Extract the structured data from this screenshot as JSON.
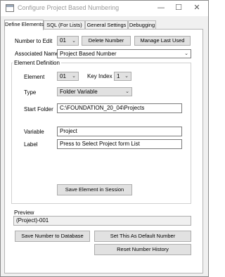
{
  "window": {
    "title": "Configure Project Based Numbering",
    "controls": {
      "minimize": "—",
      "maximize": "☐",
      "close": "✕"
    }
  },
  "tabs": [
    {
      "label": "Define Elements",
      "active": true
    },
    {
      "label": "SQL (For Lists)",
      "active": false
    },
    {
      "label": "General Settings",
      "active": false
    },
    {
      "label": "Debugging",
      "active": false
    }
  ],
  "top": {
    "number_label": "Number to Edit",
    "number_value": "01",
    "delete_button": "Delete Number",
    "manage_button": "Manage Last Used",
    "associated_label": "Associated Name",
    "associated_value": "Project Based Number"
  },
  "element_definition": {
    "group_title": "Element Definition",
    "element_label": "Element",
    "element_value": "01",
    "key_index_label": "Key Index",
    "key_index_value": "1",
    "type_label": "Type",
    "type_value": "Folder Variable",
    "start_folder_label": "Start Folder",
    "start_folder_value": "C:\\FOUNDATION_20_04\\Projects",
    "variable_label": "Variable",
    "variable_value": "Project",
    "label_label": "Label",
    "label_value": "Press to Select Project form List",
    "save_element_button": "Save Element in Session"
  },
  "preview": {
    "label": "Preview",
    "value": "(Project)-001"
  },
  "bottom": {
    "save_db_button": "Save Number to Database",
    "set_default_button": "Set This As Default Number",
    "reset_history_button": "Reset Number History"
  },
  "icons": {
    "dropdown": "chevron-down-icon",
    "app": "form-icon"
  }
}
